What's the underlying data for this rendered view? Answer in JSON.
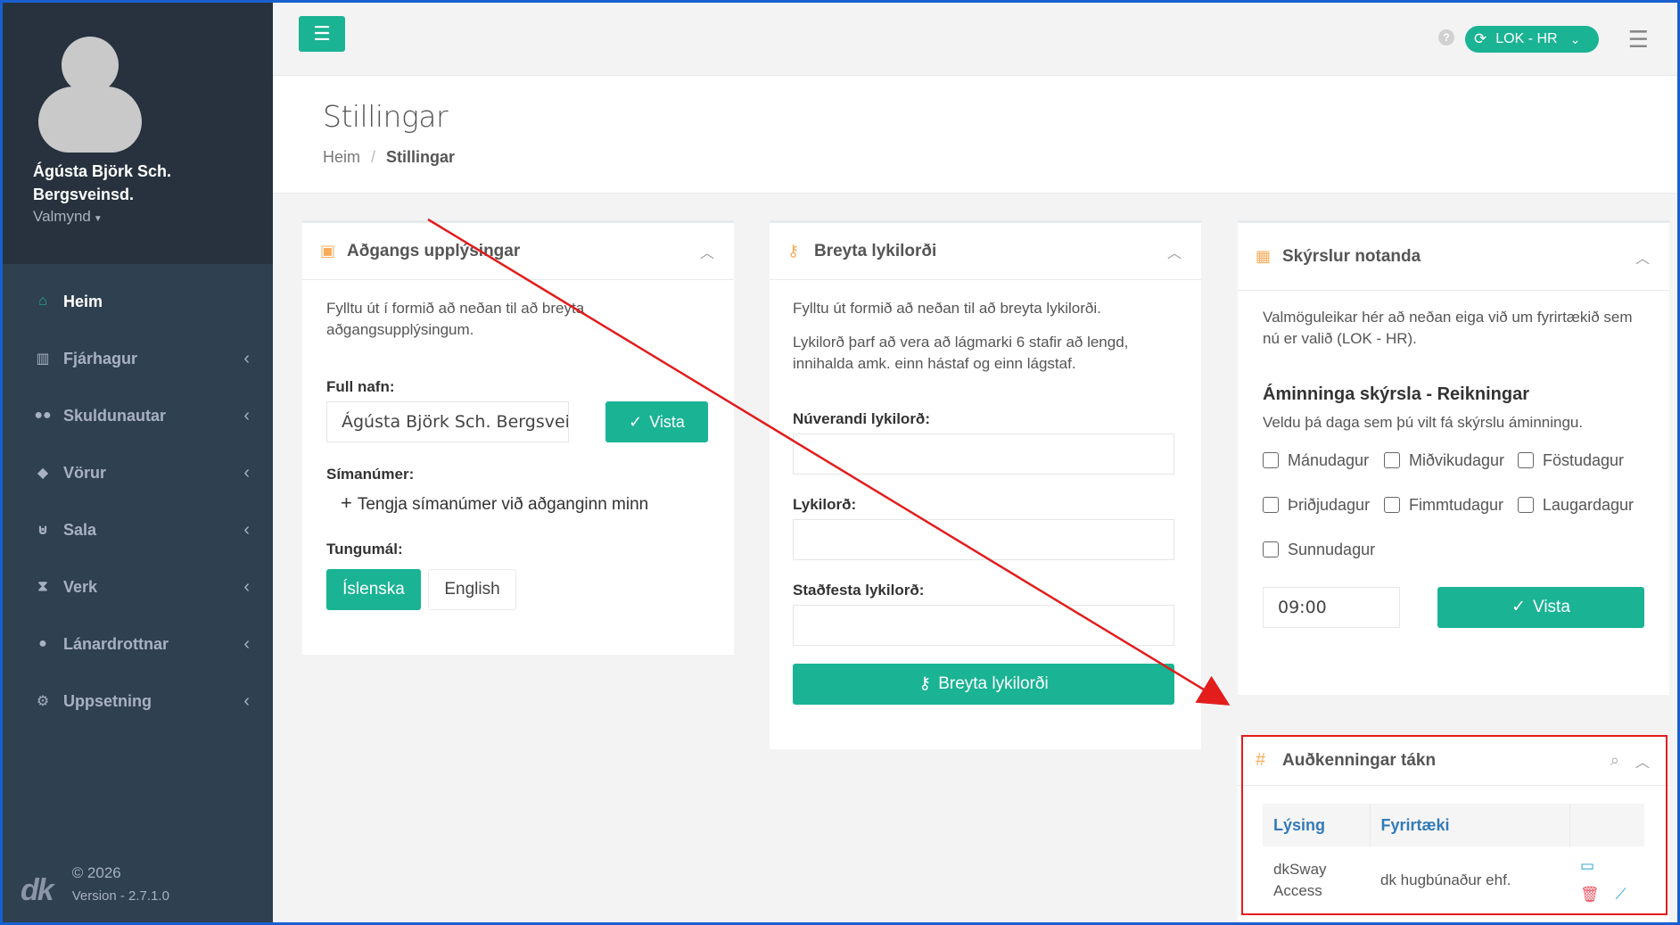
{
  "user": {
    "name": "Ágústa Björk Sch. Bergsveinsd.",
    "role": "Valmynd"
  },
  "nav": [
    {
      "label": "Heim",
      "icon": "home-icon",
      "glyph": "⌂",
      "active": true
    },
    {
      "label": "Fjárhagur",
      "icon": "book-icon",
      "glyph": "▥"
    },
    {
      "label": "Skuldunautar",
      "icon": "users-icon",
      "glyph": "👥"
    },
    {
      "label": "Vörur",
      "icon": "tag-icon",
      "glyph": "◆"
    },
    {
      "label": "Sala",
      "icon": "basket-icon",
      "glyph": "⌂"
    },
    {
      "label": "Verk",
      "icon": "hourglass-icon",
      "glyph": "⌛"
    },
    {
      "label": "Lánardrottnar",
      "icon": "user-circle-icon",
      "glyph": "●"
    },
    {
      "label": "Uppsetning",
      "icon": "cogs-icon",
      "glyph": "⚙"
    }
  ],
  "footer": {
    "copyright": "© 2026",
    "version": "Version - 2.7.1.0",
    "logo": "dk"
  },
  "topbar": {
    "help": "?",
    "company": "LOK - HR"
  },
  "header": {
    "title": "Stillingar",
    "breadcrumb_home": "Heim",
    "breadcrumb_sep": "/",
    "breadcrumb_current": "Stillingar"
  },
  "access": {
    "title": "Aðgangs upplýsingar",
    "intro": "Fylltu út í formið að neðan til að breyta aðgangsupplýsingum.",
    "fullname_label": "Full nafn:",
    "fullname_value": "Ágústa Björk Sch. Bergsveinsd.",
    "save": "Vista",
    "phone_label": "Símanúmer:",
    "phone_add": "Tengja símanúmer við aðganginn minn",
    "lang_label": "Tungumál:",
    "lang_is": "Íslenska",
    "lang_en": "English"
  },
  "password": {
    "title": "Breyta lykilorði",
    "intro1": "Fylltu út formið að neðan til að breyta lykilorði.",
    "intro2": "Lykilorð þarf að vera að lágmarki 6 stafir að lengd, innihalda amk. einn hástaf og einn lágstaf.",
    "current_label": "Núverandi lykilorð:",
    "new_label": "Lykilorð:",
    "confirm_label": "Staðfesta lykilorð:",
    "submit": "Breyta lykilorði"
  },
  "reports": {
    "title": "Skýrslur notanda",
    "intro": "Valmöguleikar hér að neðan eiga við um fyrirtækið sem nú er valið (LOK - HR).",
    "subtitle": "Áminninga skýrsla - Reikningar",
    "hint": "Veldu þá daga sem þú vilt fá skýrslu áminningu.",
    "days": [
      "Mánudagur",
      "Miðvikudagur",
      "Föstudagur",
      "Þriðjudagur",
      "Fimmtudagur",
      "Laugardagur",
      "Sunnudagur"
    ],
    "time": "09:00",
    "save": "Vista"
  },
  "tokens": {
    "title": "Auðkenningar tákn",
    "col_desc": "Lýsing",
    "col_company": "Fyrirtæki",
    "rows": [
      {
        "desc": "dkSway Access",
        "company": "dk hugbúnaður ehf."
      }
    ]
  },
  "colors": {
    "accent": "#1ab394",
    "sidebar": "#2f4050",
    "annotation": "#e31c1c"
  }
}
